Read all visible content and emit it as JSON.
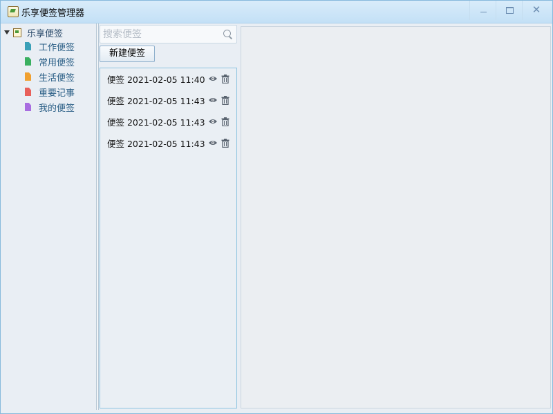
{
  "window": {
    "title": "乐享便签管理器",
    "buttons": {
      "minimize": "minimize-icon",
      "maximize": "maximize-icon",
      "close": "close-icon"
    }
  },
  "tree": {
    "root": {
      "label": "乐享便签",
      "icon": "notebook-icon"
    },
    "items": [
      {
        "label": "工作便签",
        "icon": "document-icon",
        "color": "#3aa0b8"
      },
      {
        "label": "常用便签",
        "icon": "document-icon",
        "color": "#3ab060"
      },
      {
        "label": "生活便签",
        "icon": "document-icon",
        "color": "#f0a030"
      },
      {
        "label": "重要记事",
        "icon": "document-icon",
        "color": "#e8605a"
      },
      {
        "label": "我的便签",
        "icon": "document-icon",
        "color": "#a86de0"
      }
    ]
  },
  "search": {
    "placeholder": "搜索便签",
    "value": "",
    "icon": "search-icon"
  },
  "new_button": {
    "label": "新建便签"
  },
  "notes": [
    {
      "title": "便签 2021-02-05 11:40",
      "view_icon": "eye-icon",
      "delete_icon": "trash-icon"
    },
    {
      "title": "便签 2021-02-05 11:43",
      "view_icon": "eye-icon",
      "delete_icon": "trash-icon"
    },
    {
      "title": "便签 2021-02-05 11:43",
      "view_icon": "eye-icon",
      "delete_icon": "trash-icon"
    },
    {
      "title": "便签 2021-02-05 11:43",
      "view_icon": "eye-icon",
      "delete_icon": "trash-icon"
    }
  ],
  "colors": {
    "accent_border": "#8cc3e0",
    "titlebar": "#c9e4f8",
    "panel_bg": "#e9eef4"
  }
}
